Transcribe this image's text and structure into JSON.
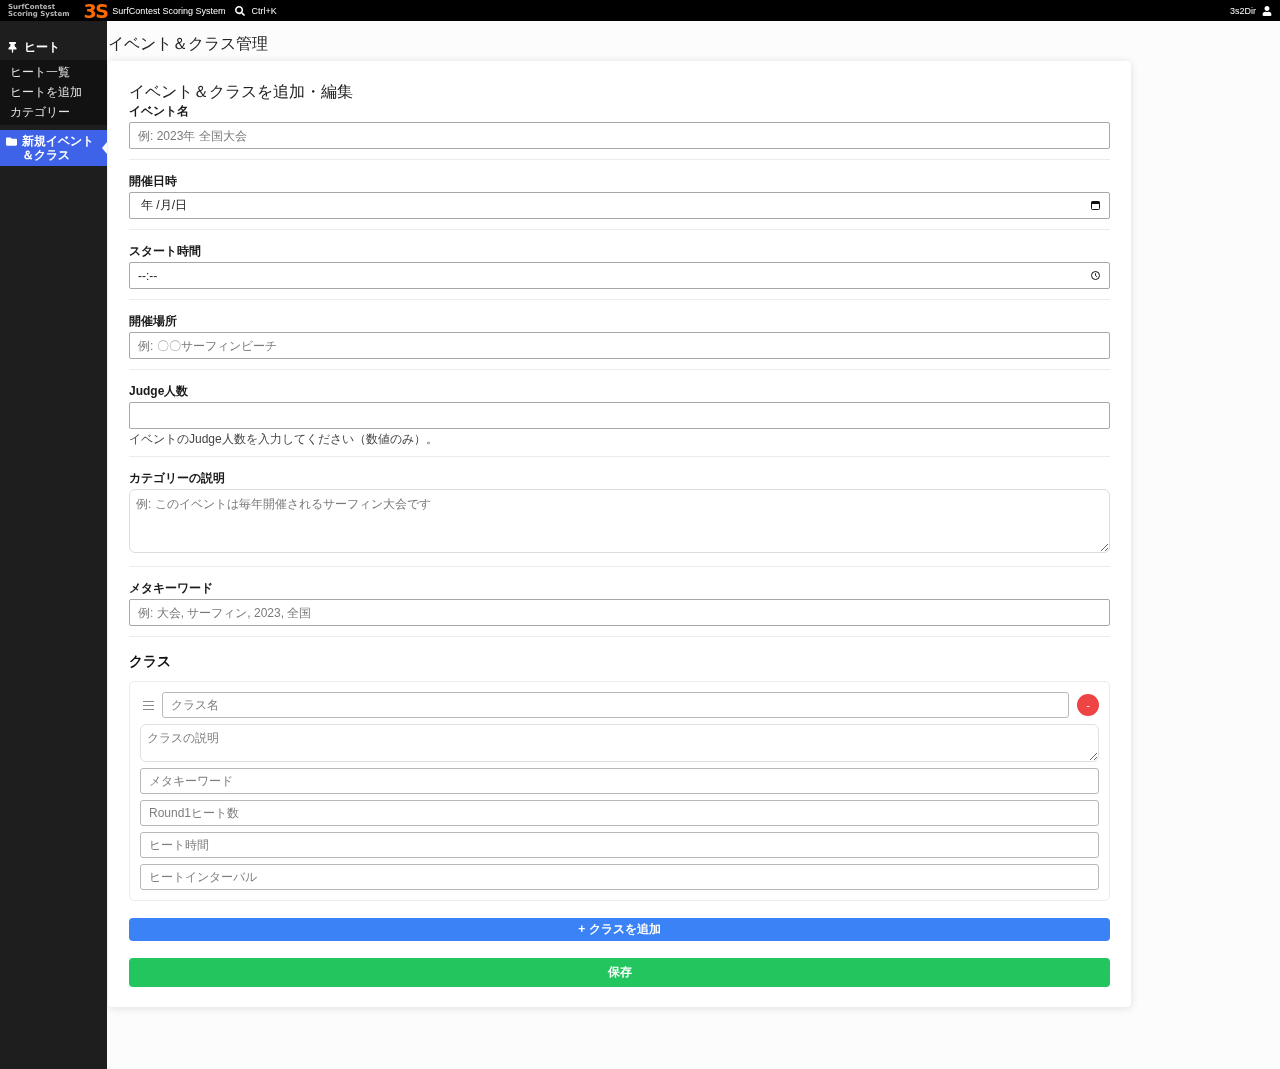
{
  "topbar": {
    "wordmark": [
      "SurfContest",
      "Scoring System"
    ],
    "brand_mark": "3S",
    "app_name": "SurfContest Scoring System",
    "search_shortcut": "Ctrl+K",
    "user_name": "3s2Dir"
  },
  "sidebar": {
    "items": [
      {
        "kind": "group",
        "label": "ヒート",
        "selected": false,
        "children": [
          {
            "label": "ヒート一覧",
            "selected": false
          },
          {
            "label": "ヒートを追加",
            "selected": false
          },
          {
            "label": "カテゴリー",
            "selected": false
          }
        ]
      },
      {
        "kind": "link",
        "label": "新規イベント＆クラス",
        "selected": true
      }
    ]
  },
  "page_title": "イベント＆クラス管理",
  "form": {
    "title": "イベント＆クラスを追加・編集",
    "fields": [
      {
        "kind": "text",
        "label": "イベント名",
        "placeholder": "例: 2023年 全国大会"
      },
      {
        "kind": "date",
        "label": "開催日時",
        "value": "年 /月/日"
      },
      {
        "kind": "time",
        "label": "スタート時間",
        "value": "--:--"
      },
      {
        "kind": "text",
        "label": "開催場所",
        "placeholder": "例: 〇〇サーフィンビーチ"
      },
      {
        "kind": "number",
        "label": "Judge人数",
        "help": "イベントのJudge人数を入力してください（数値のみ）。"
      },
      {
        "kind": "textarea",
        "label": "カテゴリーの説明",
        "placeholder": "例: このイベントは毎年開催されるサーフィン大会です"
      },
      {
        "kind": "text",
        "label": "メタキーワード",
        "placeholder": "例: 大会, サーフィン, 2023, 全国"
      }
    ],
    "classes_heading": "クラス",
    "classes": [
      {
        "name_placeholder": "クラス名",
        "remove_button": "-",
        "fields": [
          {
            "kind": "textarea",
            "placeholder": "クラスの説明"
          },
          {
            "kind": "text",
            "placeholder": "メタキーワード"
          },
          {
            "kind": "text",
            "placeholder": "Round1ヒート数"
          },
          {
            "kind": "text",
            "placeholder": "ヒート時間"
          },
          {
            "kind": "text",
            "placeholder": "ヒートインターバル"
          }
        ]
      }
    ],
    "add_class_button": "+ クラスを追加",
    "save_button": "保存"
  }
}
